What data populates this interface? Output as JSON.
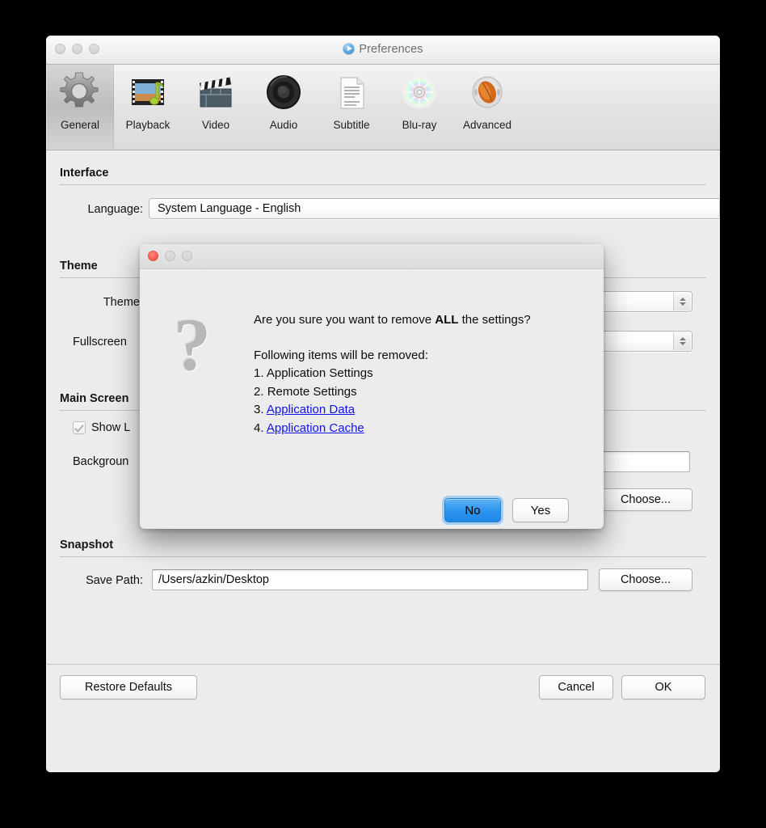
{
  "window": {
    "title": "Preferences",
    "title_icon": "media-play-circle-icon",
    "traffic_lights": [
      "close",
      "minimize",
      "zoom"
    ]
  },
  "toolbar": {
    "items": [
      {
        "label": "General",
        "icon": "gear-icon",
        "selected": true
      },
      {
        "label": "Playback",
        "icon": "filmstrip-icon",
        "selected": false
      },
      {
        "label": "Video",
        "icon": "clapperboard-icon",
        "selected": false
      },
      {
        "label": "Audio",
        "icon": "speaker-icon",
        "selected": false
      },
      {
        "label": "Subtitle",
        "icon": "document-lines-icon",
        "selected": false
      },
      {
        "label": "Blu-ray",
        "icon": "disc-icon",
        "selected": false
      },
      {
        "label": "Advanced",
        "icon": "nut-icon",
        "selected": false
      }
    ]
  },
  "sections": {
    "interface": {
      "title": "Interface",
      "language_label": "Language:",
      "language_value": "System Language - English"
    },
    "theme": {
      "title": "Theme",
      "theme_label": "Theme:",
      "theme_value": "",
      "fullscreen_label": "Fullscreen",
      "fullscreen_value": ""
    },
    "main_screen": {
      "title": "Main Screen",
      "show_logo_label": "Show L",
      "show_logo_checked": true,
      "background_label": "Backgroun",
      "background_value": "",
      "choose_label": "Choose..."
    },
    "snapshot": {
      "title": "Snapshot",
      "save_path_label": "Save Path:",
      "save_path_value": "/Users/azkin/Desktop",
      "choose_label": "Choose..."
    }
  },
  "bottom_bar": {
    "restore_defaults": "Restore Defaults",
    "cancel": "Cancel",
    "ok": "OK"
  },
  "dialog": {
    "icon": "question-mark-icon",
    "traffic_lights": [
      "close",
      "minimize",
      "zoom"
    ],
    "message_prefix": "Are you sure you want to remove ",
    "message_strong": "ALL",
    "message_suffix": " the settings?",
    "list_header": "Following items will be removed:",
    "items": [
      {
        "number": "1.",
        "text": "Application Settings",
        "link": false
      },
      {
        "number": "2.",
        "text": "Remote Settings",
        "link": false
      },
      {
        "number": "3.",
        "text": "Application Data",
        "link": true
      },
      {
        "number": "4.",
        "text": "Application Cache",
        "link": true
      }
    ],
    "no_label": "No",
    "yes_label": "Yes",
    "default_button": "No"
  },
  "colors": {
    "default_button_blue": "#2f95ef",
    "link_blue": "#1111ee",
    "window_bg": "#ececec",
    "close_red": "#fb6055",
    "desktop": "#000000"
  }
}
